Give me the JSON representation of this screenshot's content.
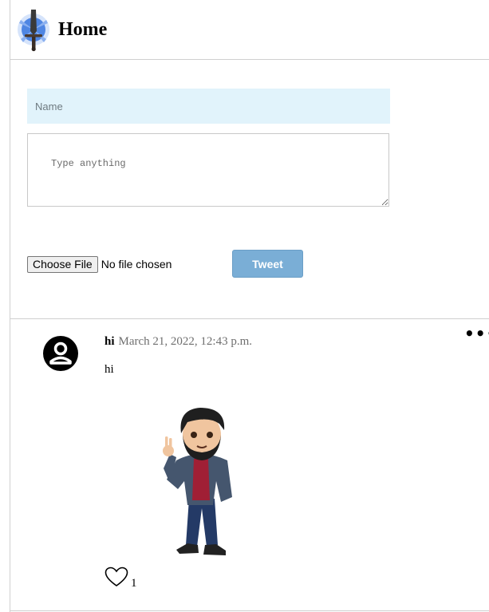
{
  "header": {
    "title": "Home",
    "logo_icon": "sword-logo-icon"
  },
  "composer": {
    "name_placeholder": "Name",
    "text_placeholder": "Type anything",
    "file_button_label": "Choose File",
    "file_status": "No file chosen",
    "tweet_button_label": "Tweet",
    "tweet_button_color": "#7aaed6",
    "name_field_color": "#e1f3fb"
  },
  "tweet": {
    "avatar_icon": "user-avatar-icon",
    "username": "hi",
    "date": "March 21, 2022, 12:43 p.m.",
    "text": "hi",
    "image_icon": "cartoon-man-image",
    "like_icon": "heart-icon",
    "like_count": "1",
    "more_icon": "more-options-icon",
    "more_glyph": "•••"
  }
}
